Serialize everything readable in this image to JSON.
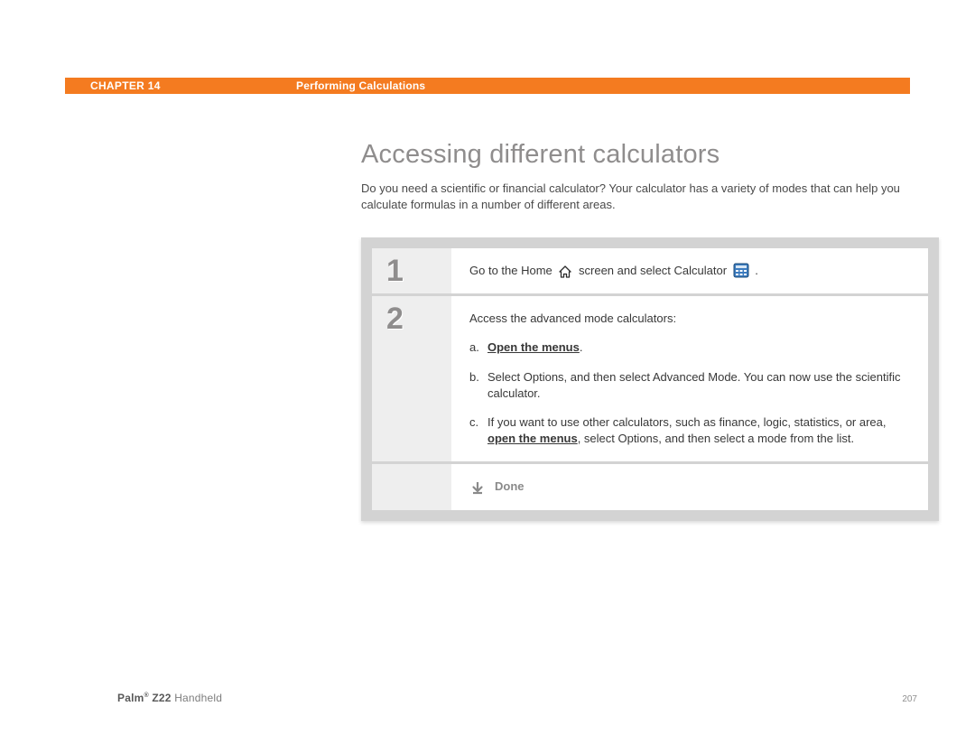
{
  "header": {
    "chapter_label": "CHAPTER 14",
    "chapter_title": "Performing Calculations"
  },
  "main": {
    "section_title": "Accessing different calculators",
    "intro": "Do you need a scientific or financial calculator? Your calculator has a variety of modes that can help you calculate formulas in a number of different areas."
  },
  "steps": [
    {
      "num": "1",
      "text_pre": "Go to the Home ",
      "text_mid": " screen and select Calculator ",
      "text_post": "."
    },
    {
      "num": "2",
      "lead": "Access the advanced mode calculators:",
      "subs": [
        {
          "letter": "a.",
          "bold_link": "Open the menus",
          "after": "."
        },
        {
          "letter": "b.",
          "text": "Select Options, and then select Advanced Mode. You can now use the scientific calculator."
        },
        {
          "letter": "c.",
          "pre": "If you want to use other calculators, such as finance, logic, statistics, or area, ",
          "bold_link": "open the menus",
          "after": ", select Options, and then select a mode from the list."
        }
      ]
    }
  ],
  "done_label": "Done",
  "footer": {
    "product_bold": "Palm",
    "product_mid": " Z22",
    "product_tail": " Handheld",
    "page": "207"
  }
}
